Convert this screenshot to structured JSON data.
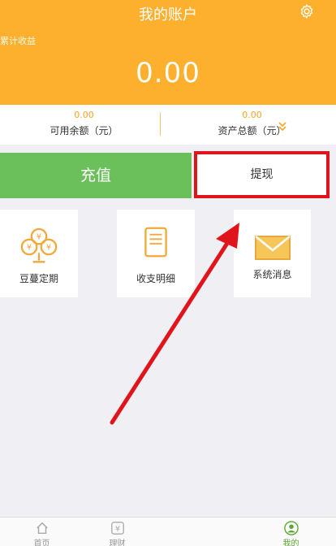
{
  "header": {
    "title": "我的账户",
    "cumulative_label": "累计收益",
    "cumulative_value": "0.00",
    "settings_icon": "gear-icon"
  },
  "stats": {
    "available": {
      "value": "0.00",
      "label": "可用余额（元）"
    },
    "total": {
      "value": "0.00",
      "label": "资产总额（元）"
    }
  },
  "actions": {
    "recharge": "充值",
    "withdraw": "提现"
  },
  "tiles": [
    {
      "label": "豆蔓定期",
      "icon": "coin-tree-icon"
    },
    {
      "label": "收支明细",
      "icon": "document-icon"
    },
    {
      "label": "系统消息",
      "icon": "envelope-icon"
    }
  ],
  "tabbar": [
    {
      "label": "首页",
      "icon": "home-icon"
    },
    {
      "label": "理财",
      "icon": "yen-icon"
    },
    {
      "label": "",
      "icon": ""
    },
    {
      "label": "我的",
      "icon": "user-icon"
    }
  ],
  "colors": {
    "header": "#fcb02e",
    "recharge": "#6cc05b",
    "highlight": "#e0141a"
  }
}
